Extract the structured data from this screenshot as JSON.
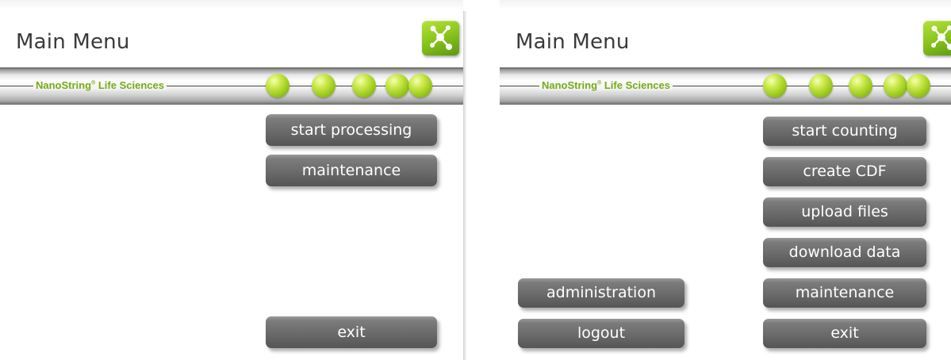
{
  "screens": [
    {
      "title": "Main Menu",
      "logo_icon": "nanostring-molecule-icon",
      "banner": {
        "brand_text": "NanoString",
        "brand_registered": "®",
        "brand_suffix": "Life Sciences",
        "dot_count": 5
      },
      "buttons": {
        "start_processing": "start processing",
        "maintenance": "maintenance",
        "exit": "exit"
      }
    },
    {
      "title": "Main Menu",
      "logo_icon": "nanostring-molecule-icon",
      "banner": {
        "brand_text": "NanoString",
        "brand_registered": "®",
        "brand_suffix": "Life Sciences",
        "dot_count": 5
      },
      "buttons": {
        "start_counting": "start counting",
        "create_cdf": "create CDF",
        "upload_files": "upload files",
        "download_data": "download data",
        "administration": "administration",
        "maintenance": "maintenance",
        "logout": "logout",
        "exit": "exit"
      }
    }
  ],
  "colors": {
    "accent_green": "#8cc63f",
    "brand_text_green": "#77aa18",
    "button_gray": "#6a6a6a",
    "button_text": "#ffffff",
    "title_text": "#3a3a3a"
  }
}
